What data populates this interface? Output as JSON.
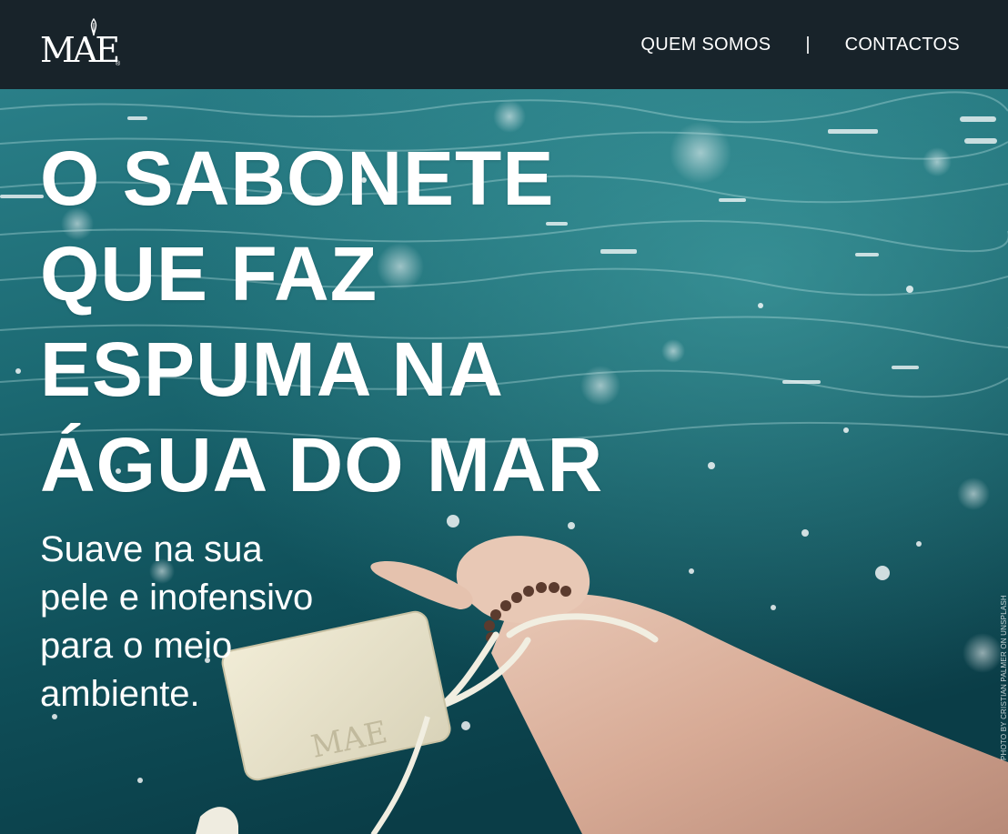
{
  "header": {
    "logo_text": "MAE",
    "logo_reg": "®",
    "nav": {
      "about_label": "QUEM SOMOS",
      "separator": "|",
      "contacts_label": "CONTACTOS"
    }
  },
  "hero": {
    "headline": [
      "O SABONETE",
      "QUE FAZ",
      "ESPUMA NA",
      "ÁGUA DO MAR"
    ],
    "subline": [
      "Suave na sua",
      "pele e inofensivo",
      "para o meio",
      "ambiente."
    ],
    "photo_credit": "PHOTO BY CRISTIAN PALMER ON UNSPLASH",
    "soap_stamp": "MAE"
  },
  "colors": {
    "header_bg": "#18232a",
    "water_dark": "#0b3e48",
    "water_light": "#2f8d96",
    "text": "#ffffff"
  },
  "icons": {
    "logo_leaf": "leaf-icon"
  }
}
